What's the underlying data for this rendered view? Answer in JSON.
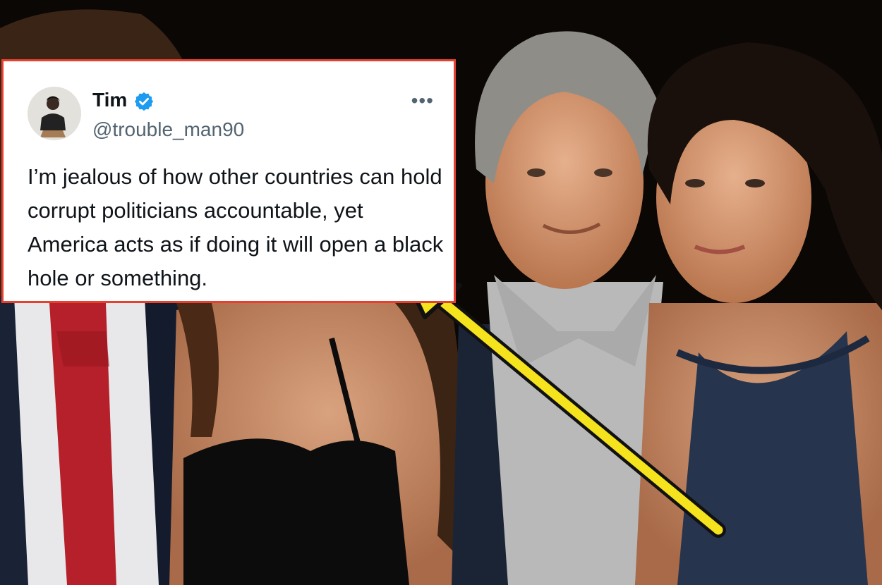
{
  "tweet": {
    "author_name": "Tim",
    "author_handle": "@trouble_man90",
    "verified": true,
    "text": "I’m jealous of how other countries can hold corrupt politicians accountable, yet America acts as if doing it will open a black hole or something.",
    "icons": [
      "avatar",
      "verified-badge-icon",
      "more-options-icon"
    ]
  },
  "colors": {
    "card_border": "#e8402f",
    "verified_blue": "#1d9bf0",
    "arrow_yellow": "#f5e31d"
  }
}
